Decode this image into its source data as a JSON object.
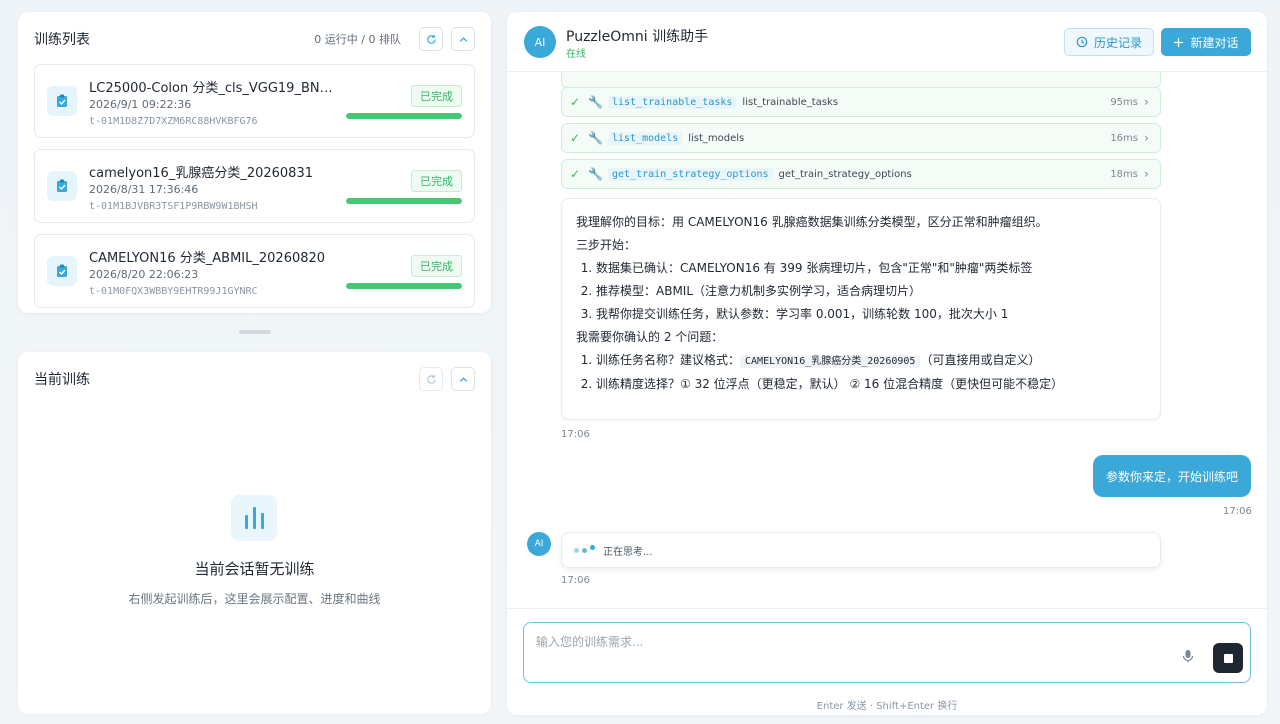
{
  "training_list": {
    "title": "训练列表",
    "queue_info": "0 运行中 / 0 排队",
    "tasks": [
      {
        "name": "LC25000-Colon 分类_cls_VGG19_BN_20…",
        "time": "2026/9/1 09:22:36",
        "id": "t-01M1D8Z7D7XZM6RC88HVKBFG76",
        "status": "已完成",
        "progress": 1.0
      },
      {
        "name": "camelyon16_乳腺癌分类_20260831",
        "time": "2026/8/31 17:36:46",
        "id": "t-01M1BJVBR3TSF1P9RBW9W1BHSH",
        "status": "已完成",
        "progress": 1.0
      },
      {
        "name": "CAMELYON16 分类_ABMIL_20260820",
        "time": "2026/8/20 22:06:23",
        "id": "t-01M0FQX3WBBY9EHTR99J1GYNRC",
        "status": "已完成",
        "progress": 1.0
      }
    ]
  },
  "current_training": {
    "title": "当前训练",
    "empty_title": "当前会话暂无训练",
    "empty_subtitle": "右侧发起训练后，这里会展示配置、进度和曲线"
  },
  "chat": {
    "avatar": "AI",
    "assistant_name": "PuzzleOmni 训练助手",
    "online": "在线",
    "history_label": "历史记录",
    "new_chat_label": "新建对话",
    "tools": [
      {
        "code": "list_trainable_tasks",
        "name": "list_trainable_tasks",
        "duration": "95ms"
      },
      {
        "code": "list_models",
        "name": "list_models",
        "duration": "16ms"
      },
      {
        "code": "get_train_strategy_options",
        "name": "get_train_strategy_options",
        "duration": "18ms"
      }
    ],
    "message": {
      "intro": "我理解你的目标：用 CAMELYON16 乳腺癌数据集训练分类模型，区分正常和肿瘤组织。",
      "steps_title": "三步开始：",
      "steps": [
        "数据集已确认：CAMELYON16 有 399 张病理切片，包含\"正常\"和\"肿瘤\"两类标签",
        "推荐模型：ABMIL（注意力机制多实例学习，适合病理切片）",
        "我帮你提交训练任务，默认参数：学习率 0.001，训练轮数 100，批次大小 1"
      ],
      "confirm_title": "我需要你确认的 2 个问题：",
      "q1_prefix": "训练任务名称？建议格式：",
      "q1_code": "CAMELYON16_乳腺癌分类_20260905",
      "q1_suffix": "（可直接用或自定义）",
      "q2": "训练精度选择？① 32 位浮点（更稳定，默认） ② 16 位混合精度（更快但可能不稳定）",
      "time": "17:06"
    },
    "user_message": {
      "text": "参数你来定，开始训练吧",
      "time": "17:06"
    },
    "thinking": {
      "text": "正在思考...",
      "time": "17:06"
    },
    "input": {
      "placeholder": "输入您的训练需求...",
      "hint": "Enter 发送 · Shift+Enter 换行"
    }
  },
  "colors": {
    "accent": "#3aa8d8",
    "success": "#46c774",
    "dark": "#1f2733"
  }
}
